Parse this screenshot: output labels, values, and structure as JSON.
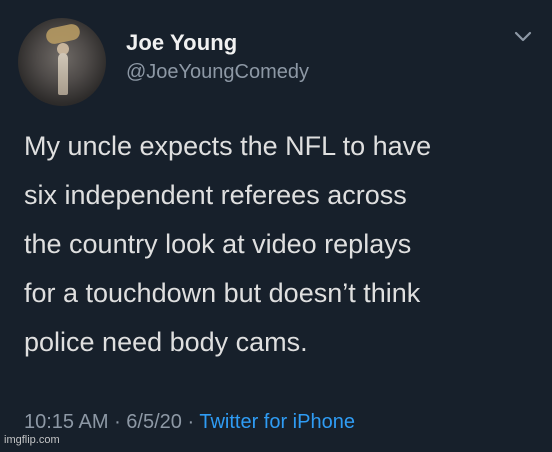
{
  "tweet": {
    "author_name": "Joe Young",
    "author_handle": "@JoeYoungComedy",
    "text": "My uncle expects the NFL to have\nsix independent referees across\nthe country look at video replays\nfor a touchdown but doesn’t think\npolice need body cams.",
    "time": "10:15 AM",
    "separator_1": " · ",
    "date": "6/5/20",
    "separator_2": " · ",
    "source": "Twitter for iPhone",
    "options_icon": "chevron-down-icon",
    "avatar_icon": "avatar"
  },
  "watermark": {
    "text": "imgflip.com"
  },
  "colors": {
    "background": "#17202b",
    "primary_text": "#dfdfdf",
    "secondary_text": "#8d98a5",
    "accent": "#2f9cf4"
  }
}
